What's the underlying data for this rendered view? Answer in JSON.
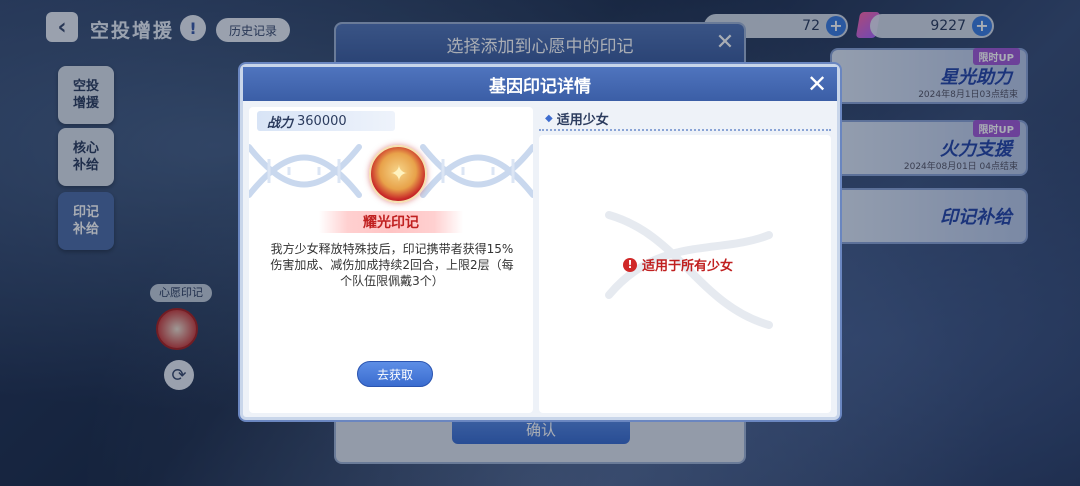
{
  "header": {
    "back_icon": "chevron-left-icon",
    "title": "空投增援",
    "info_icon": "info-icon",
    "history_label": "历史记录"
  },
  "sidebar": {
    "tabs": [
      {
        "label": "空投\n增援",
        "active": false
      },
      {
        "label": "核心\n补给",
        "active": false
      },
      {
        "label": "印记\n补给",
        "active": true
      }
    ],
    "wish_label": "心愿印记"
  },
  "currency": {
    "first_value": "72",
    "second_value": "9227"
  },
  "banners": [
    {
      "title": "星光助力",
      "tag": "限时UP",
      "sub": "2024年8月1日03点结束"
    },
    {
      "title": "火力支援",
      "tag": "限时UP",
      "sub": "2024年08月01日 04点结束"
    },
    {
      "title": "印记补给",
      "tag": "",
      "sub": ""
    }
  ],
  "back_dialog": {
    "title": "选择添加到心愿中的印记",
    "confirm_label": "确认"
  },
  "modal": {
    "title": "基因印记详情",
    "power_label": "战力",
    "power_value": "360000",
    "item_name": "耀光印记",
    "description": "我方少女释放特殊技后，印记携带者获得15%伤害加成、减伤加成持续2回合，上限2层（每个队伍限佩戴3个）",
    "get_button": "去获取",
    "right_header": "适用少女",
    "applicable_text": "适用于所有少女"
  },
  "colors": {
    "accent_blue": "#3b5ea6",
    "warning_red": "#c02020"
  }
}
